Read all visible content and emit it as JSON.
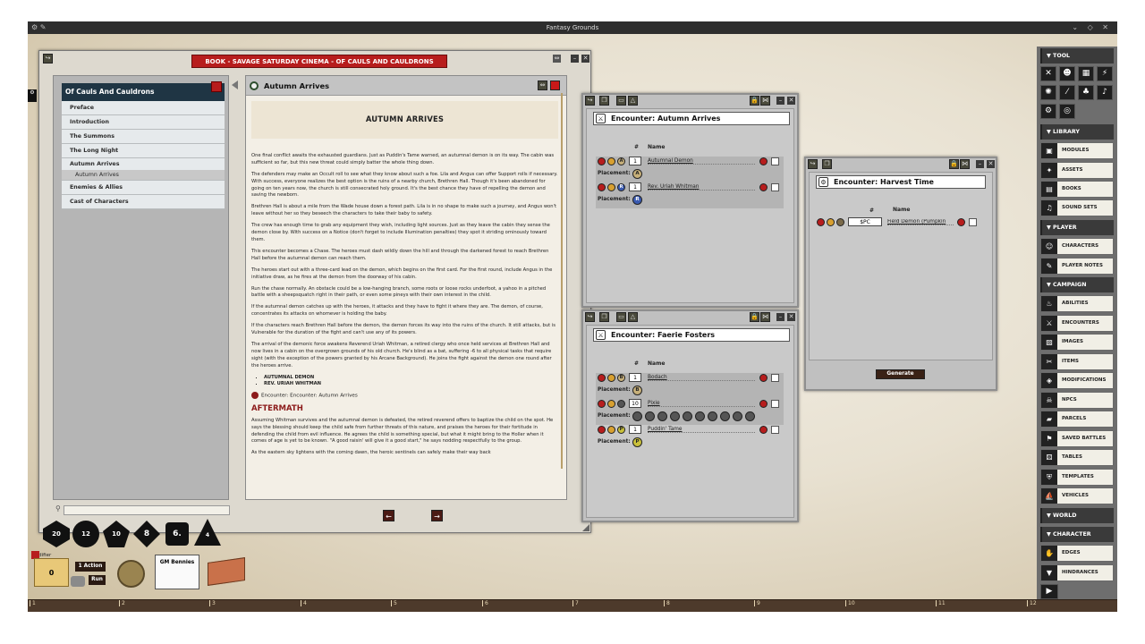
{
  "window": {
    "title": "Fantasy Grounds"
  },
  "book": {
    "title": "BOOK - SAVAGE SATURDAY CINEMA - OF CAULS AND CAULDRONS",
    "toc_title": "Of Cauls And Cauldrons",
    "toc_items": [
      "Preface",
      "Introduction",
      "The Summons",
      "The Long Night",
      "Autumn Arrives",
      "Autumn Arrives",
      "Enemies & Allies",
      "Cast of Characters"
    ],
    "page_title": "Autumn Arrives",
    "heading": "AUTUMN ARRIVES",
    "paragraphs": [
      "One final conflict awaits the exhausted guardians. Just as Puddin's Tame warned, an autumnal demon is on its way. The cabin was sufficient so far, but this new threat could simply batter the whole thing down.",
      "The defenders may make an Occult roll to see what they know about such a foe. Lila and Angus can offer Support rolls if necessary. With success, everyone realizes the best option is the ruins of a nearby church, Brethren Hall. Though it's been abandoned for going on ten years now, the church is still consecrated holy ground. It's the best chance they have of repelling the demon and saving the newborn.",
      "Brethren Hall is about a mile from the Wade house down a forest path. Lila is in no shape to make such a journey, and Angus won't leave without her so they beseech the characters to take their baby to safety.",
      "The crew has enough time to grab any equipment they wish, including light sources. Just as they leave the cabin they sense the demon close by. With success on a Notice (don't forget to include Illumination penalties) they spot it striding ominously toward them.",
      "This encounter becomes a Chase. The heroes must dash wildly down the hill and through the darkened forest to reach Brethren Hall before the autumnal demon can reach them.",
      "The heroes start out with a three-card lead on the demon, which begins on the first card. For the first round, include Angus in the initiative draw, as he fires at the demon from the doorway of his cabin.",
      "Run the chase normally. An obstacle could be a low-hanging branch, some roots or loose rocks underfoot, a yahoo in a pitched battle with a sheepsquatch right in their path, or even some pineys with their own interest in the child.",
      "If the autumnal demon catches up with the heroes, it attacks and they have to fight it where they are. The demon, of course, concentrates its attacks on whomever is holding the baby.",
      "If the characters reach Brethren Hall before the demon, the demon forces its way into the ruins of the church. It still attacks, but is Vulnerable for the duration of the fight and can't use any of its powers.",
      "The arrival of the demonic force awakens Reverend Uriah Whitman, a retired clergy who once held services at Brethren Hall and now lives in a cabin on the overgrown grounds of his old church. He's blind as a bat, suffering -6 to all physical tasks that require sight (with the exception of the powers granted by his Arcane Background). He joins the fight against the demon one round after the heroes arrive."
    ],
    "bullets": [
      "AUTUMNAL DEMON",
      "REV. URIAH WHITMAN"
    ],
    "encounter_link": "Encounter: Encounter: Autumn Arrives",
    "aftermath_heading": "AFTERMATH",
    "aftermath_paragraphs": [
      "Assuming Whitman survives and the autumnal demon is defeated, the retired reverend offers to baptize the child on the spot. He says the blessing should keep the child safe from further threats of this nature, and praises the heroes for their fortitude in defending the child from evil influence. He agrees the child is something special, but what it might bring to the Holler when it comes of age is yet to be known. \"A good raisin' will give it a good start,\" he says nodding respectfully to the group.",
      "As the eastern sky lightens with the coming dawn, the heroic sentinels can safely make their way back"
    ],
    "prev_label": "←",
    "next_label": "→"
  },
  "encounter_autumn": {
    "title": "Encounter: Autumn Arrives",
    "col_num": "#",
    "col_name": "Name",
    "placement_label": "Placement:",
    "rows": [
      {
        "count": "1",
        "name": "Autumnal Demon",
        "token": "A"
      },
      {
        "count": "1",
        "name": "Rev. Uriah Whitman",
        "token": "R"
      }
    ]
  },
  "encounter_faerie": {
    "title": "Encounter: Faerie Fosters",
    "col_num": "#",
    "col_name": "Name",
    "placement_label": "Placement:",
    "rows": [
      {
        "count": "1",
        "name": "Bodach",
        "token": "B"
      },
      {
        "count": "10",
        "name": "Pixie",
        "token": ""
      },
      {
        "count": "1",
        "name": "Puddin' Tame",
        "token": "P"
      }
    ]
  },
  "encounter_harvest": {
    "title": "Encounter: Harvest Time",
    "col_num": "#",
    "col_name": "Name",
    "rows": [
      {
        "count": "$PC",
        "name": "Field Demon (Pumpkin"
      }
    ],
    "generate_label": "Generate"
  },
  "sidebar": {
    "tool_label": "TOOL",
    "library_label": "LIBRARY",
    "library_items": [
      "MODULES",
      "ASSETS",
      "BOOKS",
      "SOUND SETS"
    ],
    "player_label": "PLAYER",
    "player_items": [
      "CHARACTERS",
      "PLAYER NOTES"
    ],
    "campaign_label": "CAMPAIGN",
    "campaign_items": [
      "ABILITIES",
      "ENCOUNTERS",
      "IMAGES",
      "ITEMS",
      "MODIFICATIONS",
      "NPCS",
      "PARCELS",
      "SAVED BATTLES",
      "TABLES",
      "TEMPLATES",
      "VEHICLES"
    ],
    "world_label": "WORLD",
    "character_label": "CHARACTER",
    "character_items": [
      "EDGES",
      "HINDRANCES"
    ]
  },
  "dice": [
    "20",
    "12",
    "10",
    "8",
    "6.",
    "4"
  ],
  "bottom": {
    "modifier_label": "Modifier",
    "modifier_value": "0",
    "action_label": "1 Action",
    "run_label": "Run",
    "gm_bennies_label": "GM Bennies"
  },
  "ruler": [
    "1",
    "2",
    "3",
    "4",
    "5",
    "6",
    "7",
    "8",
    "9",
    "10",
    "11",
    "12"
  ],
  "colors": {
    "accent_red": "#b71d1d",
    "navy": "#1f3544",
    "sidebar_dark": "#3a3a3a"
  }
}
